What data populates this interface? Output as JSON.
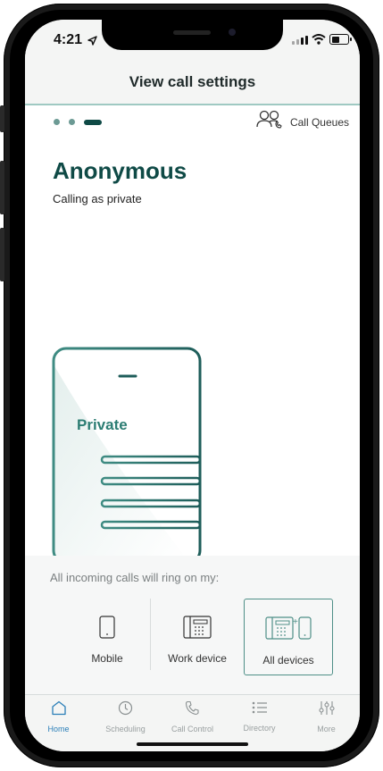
{
  "status_bar": {
    "time": "4:21"
  },
  "header": {
    "title": "View call settings"
  },
  "carousel": {
    "page_count": 3,
    "active_index": 2
  },
  "call_queues": {
    "label": "Call Queues"
  },
  "caller_id": {
    "name": "Anonymous",
    "subtitle": "Calling as private"
  },
  "illustration": {
    "label": "Private"
  },
  "ring": {
    "label": "All incoming calls will ring on my:",
    "devices": [
      {
        "label": "Mobile",
        "selected": false
      },
      {
        "label": "Work device",
        "selected": false
      },
      {
        "label": "All devices",
        "selected": true
      }
    ]
  },
  "tabs": [
    {
      "label": "Home",
      "active": true,
      "icon": "home-icon"
    },
    {
      "label": "Scheduling",
      "active": false,
      "icon": "clock-icon"
    },
    {
      "label": "Call Control",
      "active": false,
      "icon": "phone-icon"
    },
    {
      "label": "Directory",
      "active": false,
      "icon": "list-icon"
    },
    {
      "label": "More",
      "active": false,
      "icon": "sliders-icon"
    }
  ],
  "colors": {
    "brand": "#0f4a46",
    "accent": "#2b7fb8",
    "teal_line": "#4e8f87"
  }
}
